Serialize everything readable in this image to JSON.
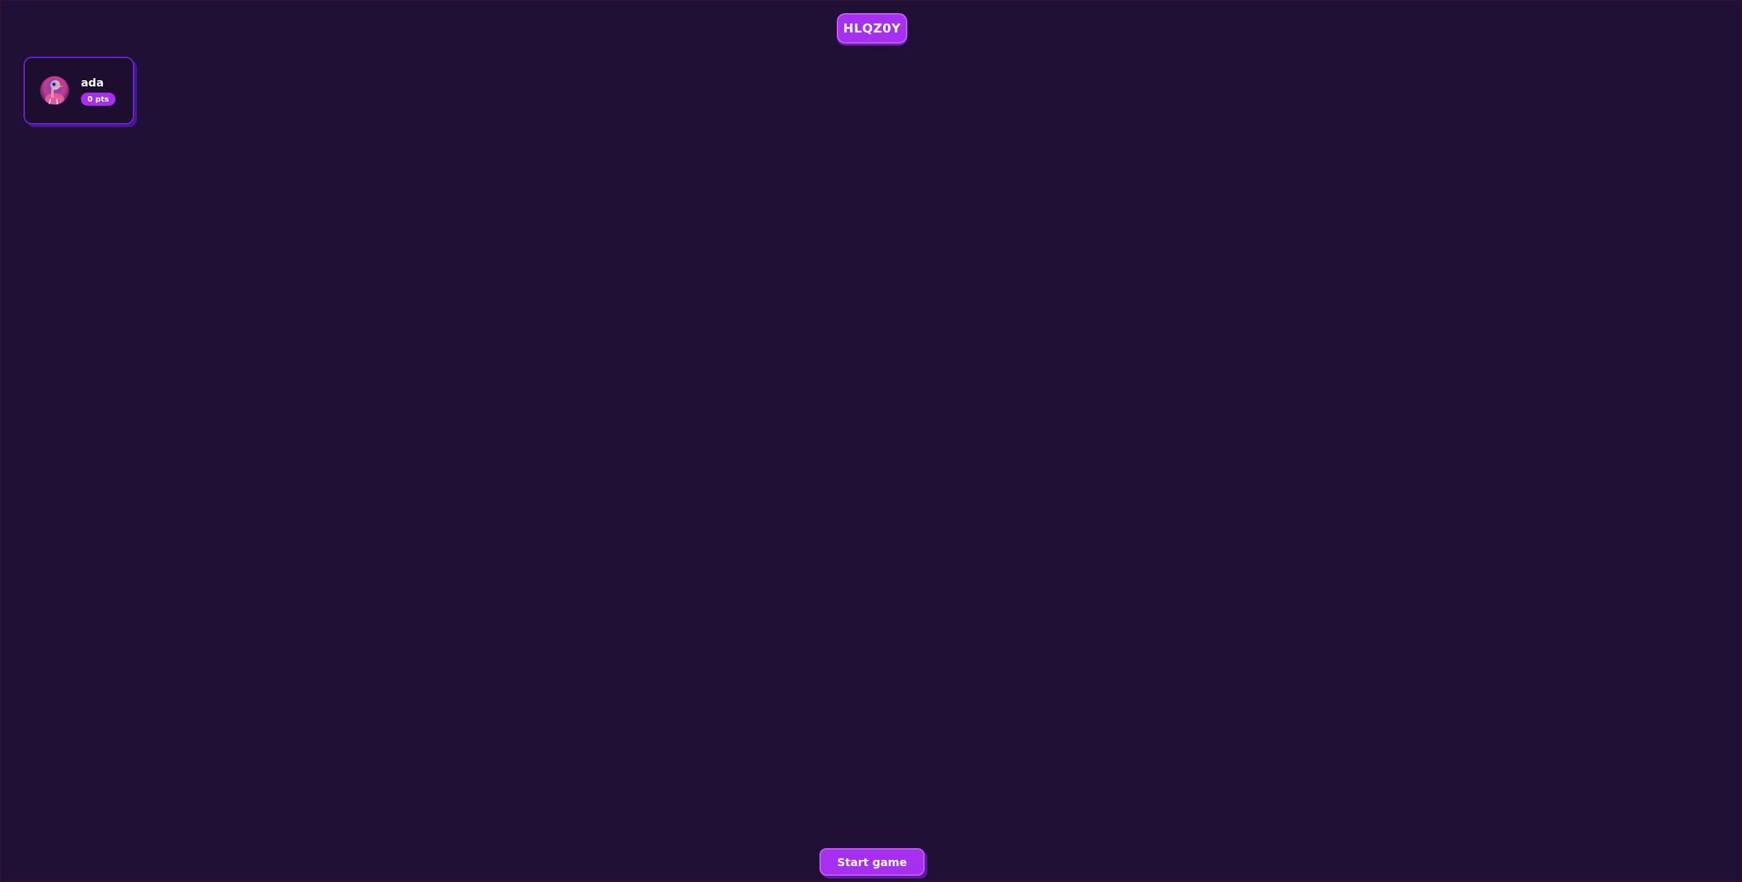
{
  "room": {
    "code": "HLQZ0Y"
  },
  "players": [
    {
      "name": "ada",
      "score_label": "0 pts",
      "avatar_icon": "ostrich-avatar-icon"
    }
  ],
  "actions": {
    "start_label": "Start game"
  },
  "colors": {
    "background": "#211035",
    "accent": "#a62ff0",
    "card_border": "#6a25c8"
  }
}
